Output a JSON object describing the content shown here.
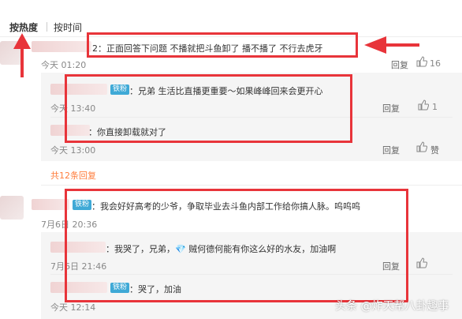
{
  "sort": {
    "hot": "按热度",
    "time": "按时间"
  },
  "actions": {
    "reply": "回复",
    "like": "赞"
  },
  "comments": [
    {
      "text": "2：正面回答下问题 不播就把斗鱼卸了 播不播了 不行去虎牙",
      "time": "今天 01:20",
      "likes": "16",
      "replies": [
        {
          "badge": "铁粉",
          "text": "：兄弟 生活比直播更重要～如果峰峰回来会更开心",
          "time": "今天 13:40",
          "likes": "1"
        },
        {
          "text": "：你直接卸载就对了",
          "time": "今天 13:00",
          "likes": ""
        }
      ],
      "more": "共12条回复"
    },
    {
      "badge": "铁粉",
      "text": "：我会好好高考的少爷，争取毕业去斗鱼内部工作给你搞人脉。呜呜呜",
      "time": "7月6日 20:36",
      "likes": "",
      "replies": [
        {
          "text": "：我哭了，兄弟，💎 贼何德何能有你这么好的水友，加油啊",
          "time": "7月6日 21:46",
          "likes": ""
        },
        {
          "badge": "铁粉",
          "text": "：哭了，加油",
          "time": "今天 12:14",
          "likes": ""
        }
      ]
    }
  ],
  "watermark": "头条 @炸天帮八卦趣事"
}
